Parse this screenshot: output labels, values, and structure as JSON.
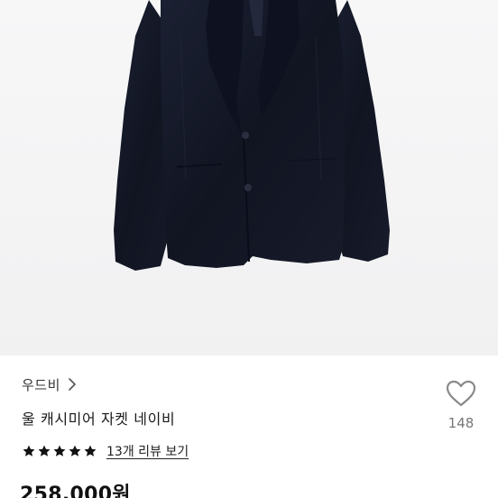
{
  "product": {
    "brand": "우드비",
    "title": "울 캐시미어 자켓 네이비",
    "rating": 5,
    "rating_max": 5,
    "review_link": "13개 리뷰 보기",
    "price": "258,000원"
  },
  "like": {
    "count": "148"
  },
  "colors": {
    "jacket": "#141826",
    "background": "#f5f5f6",
    "star": "#111111",
    "like_outline": "#8a8a8a"
  }
}
